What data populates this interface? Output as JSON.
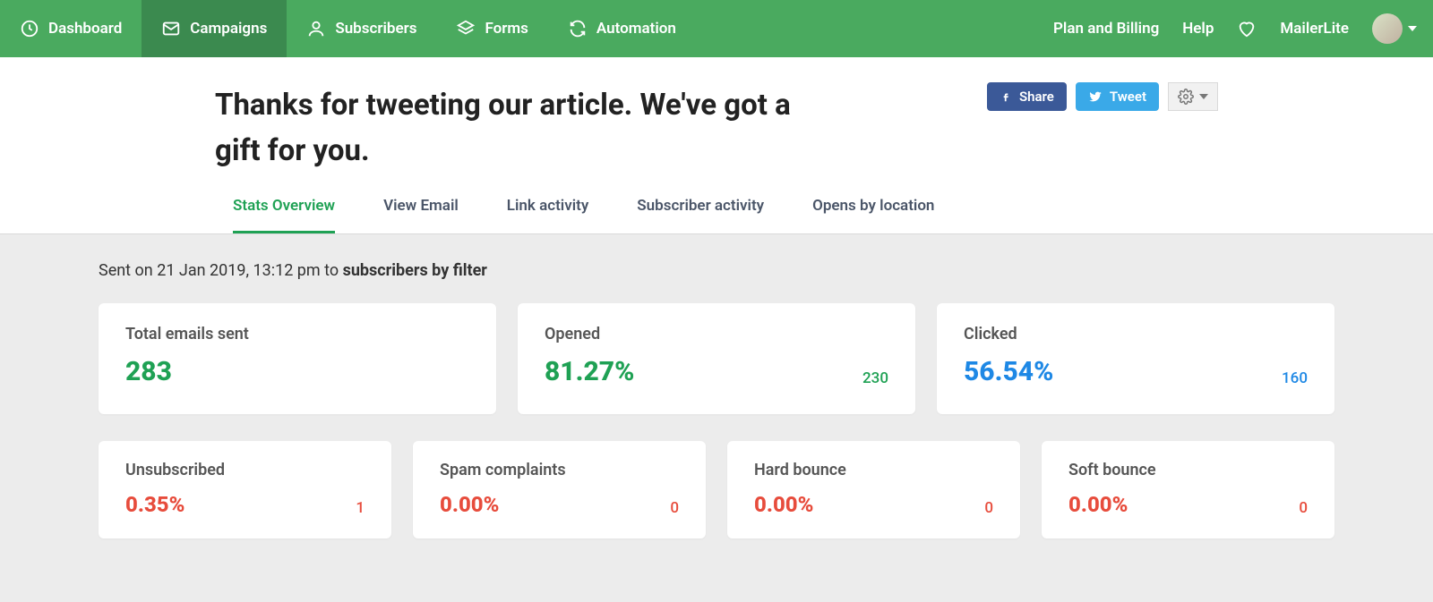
{
  "nav": {
    "items": [
      {
        "label": "Dashboard",
        "icon": "clock"
      },
      {
        "label": "Campaigns",
        "icon": "mail",
        "active": true
      },
      {
        "label": "Subscribers",
        "icon": "person"
      },
      {
        "label": "Forms",
        "icon": "layers"
      },
      {
        "label": "Automation",
        "icon": "refresh"
      }
    ],
    "plan": "Plan and Billing",
    "help": "Help",
    "brand": "MailerLite"
  },
  "page": {
    "title": "Thanks for tweeting our article. We've got a gift for you.",
    "share_label": "Share",
    "tweet_label": "Tweet"
  },
  "tabs": [
    {
      "label": "Stats Overview",
      "active": true
    },
    {
      "label": "View Email"
    },
    {
      "label": "Link activity"
    },
    {
      "label": "Subscriber activity"
    },
    {
      "label": "Opens by location"
    }
  ],
  "sent": {
    "prefix": "Sent on 21 Jan 2019, 13:12 pm to ",
    "target": "subscribers by filter"
  },
  "stats_primary": [
    {
      "label": "Total emails sent",
      "value": "283",
      "value_class": "card-green",
      "count": "",
      "count_class": ""
    },
    {
      "label": "Opened",
      "value": "81.27%",
      "value_class": "card-green",
      "count": "230",
      "count_class": "green"
    },
    {
      "label": "Clicked",
      "value": "56.54%",
      "value_class": "card-blue",
      "count": "160",
      "count_class": "blue"
    }
  ],
  "stats_secondary": [
    {
      "label": "Unsubscribed",
      "value": "0.35%",
      "count": "1"
    },
    {
      "label": "Spam complaints",
      "value": "0.00%",
      "count": "0"
    },
    {
      "label": "Hard bounce",
      "value": "0.00%",
      "count": "0"
    },
    {
      "label": "Soft bounce",
      "value": "0.00%",
      "count": "0"
    }
  ]
}
